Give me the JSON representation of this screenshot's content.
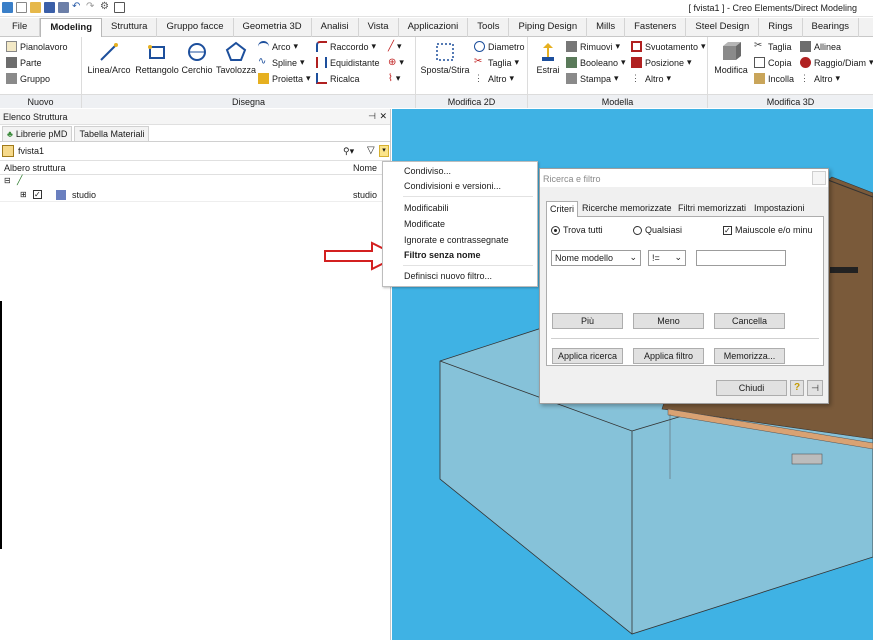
{
  "window": {
    "title": "[ fvista1 ] - Creo Elements/Direct Modeling"
  },
  "tabs": [
    "File",
    "Modeling",
    "Struttura",
    "Gruppo facce",
    "Geometria 3D",
    "Analisi",
    "Vista",
    "Applicazioni",
    "Tools",
    "Piping Design",
    "Mills",
    "Fasteners",
    "Steel Design",
    "Rings",
    "Bearings"
  ],
  "ribbon": {
    "nuovo": {
      "label": "Nuovo",
      "items": [
        "Pianolavoro",
        "Parte",
        "Gruppo"
      ]
    },
    "disegna": {
      "label": "Disegna",
      "big": [
        "Linea/Arco",
        "Rettangolo",
        "Cerchio",
        "Tavolozza"
      ],
      "col1": [
        "Arco",
        "Spline",
        "Proietta"
      ],
      "col2": [
        "Raccordo",
        "Equidistante",
        "Ricalca"
      ]
    },
    "modifica2d": {
      "label": "Modifica 2D",
      "big": "Sposta/Stira",
      "items": [
        "Diametro",
        "Taglia",
        "Altro"
      ]
    },
    "modella": {
      "label": "Modella",
      "big": "Estrai",
      "col1": [
        "Rimuovi",
        "Booleano",
        "Stampa"
      ],
      "col2": [
        "Svuotamento",
        "Posizione",
        "Altro"
      ]
    },
    "modifica3d": {
      "label": "Modifica 3D",
      "big": "Modifica",
      "col1": [
        "Taglia",
        "Copia",
        "Incolla"
      ],
      "col2": [
        "Allinea",
        "Raggio/Diam",
        "Altro"
      ]
    }
  },
  "panel": {
    "title": "Elenco Struttura",
    "tabs": [
      "Librerie pMD",
      "Tabella Materiali"
    ],
    "filter_name": "fvista1",
    "col_tree": "Albero struttura",
    "col_name": "Nome",
    "tree_item": "studio",
    "tree_item_name": "studio"
  },
  "menu": {
    "items": [
      "Condiviso...",
      "Condivisioni e versioni...",
      "Modificabili",
      "Modificate",
      "Ignorate e contrassegnate",
      "Filtro senza nome",
      "Definisci nuovo filtro..."
    ]
  },
  "dialog": {
    "title": "Ricerca e filtro",
    "tabs": [
      "Criteri",
      "Ricerche memorizzate",
      "Filtri memorizzati",
      "Impostazioni"
    ],
    "radio_all": "Trova tutti",
    "radio_any": "Qualsiasi",
    "checkbox_case": "Maiuscole e/o minu",
    "field": "Nome modello",
    "operator": "!=",
    "value": "",
    "buttons": {
      "piu": "Più",
      "meno": "Meno",
      "cancella": "Cancella",
      "applica_ricerca": "Applica ricerca",
      "applica_filtro": "Applica filtro",
      "memorizza": "Memorizza...",
      "chiudi": "Chiudi"
    }
  },
  "colors": {
    "viewport": "#3fb2e4",
    "arrow": "#d32020",
    "accent": "#2a6ebd"
  }
}
